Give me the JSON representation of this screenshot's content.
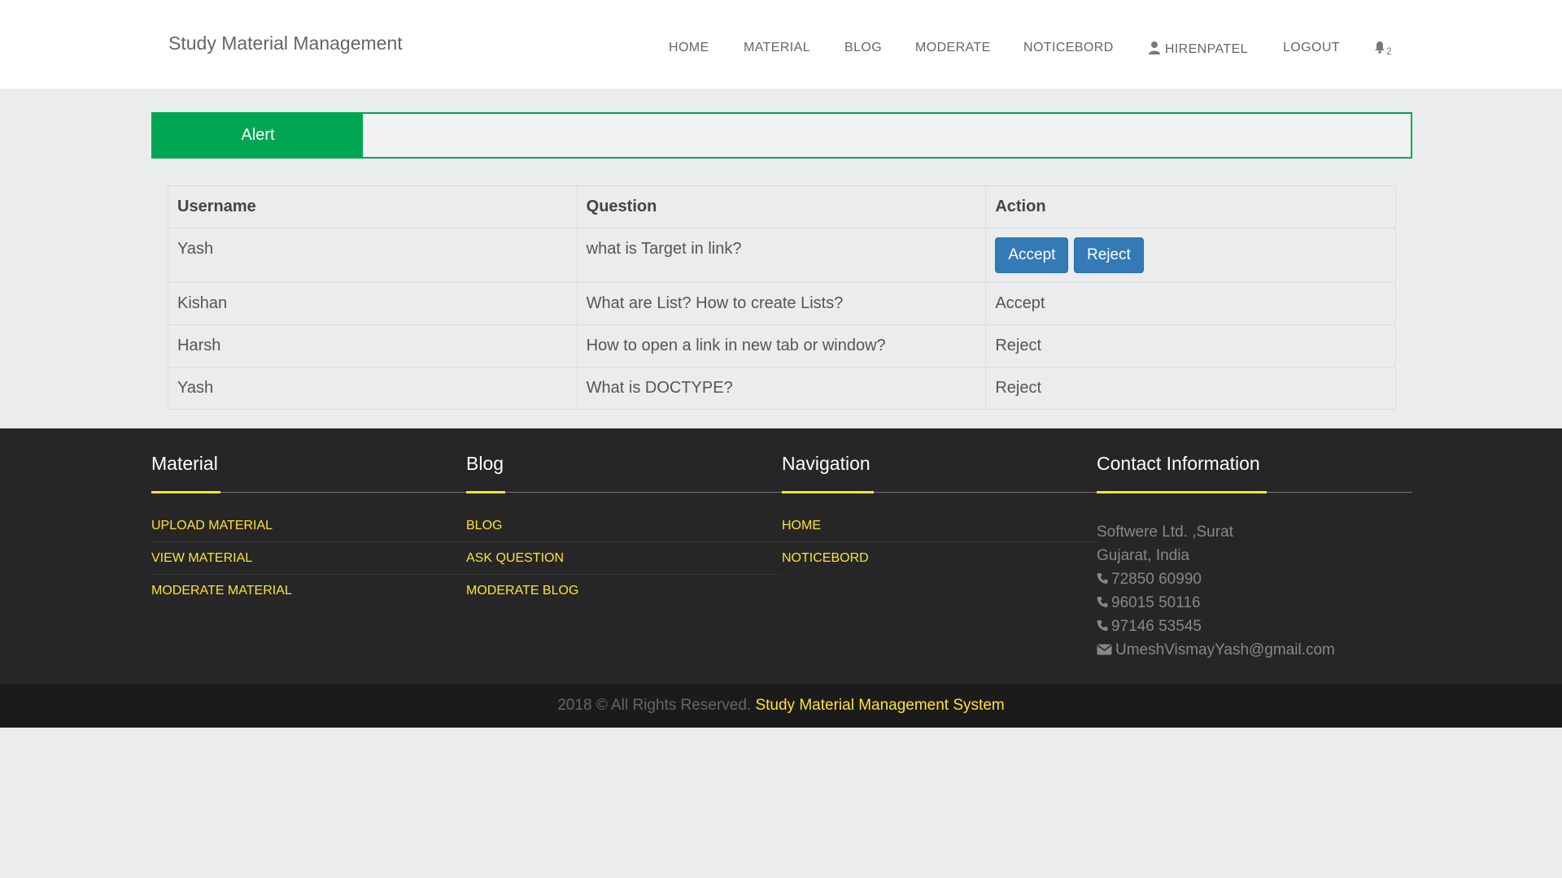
{
  "brand": "Study Material Management",
  "nav": {
    "home": "HOME",
    "material": "MATERIAL",
    "blog": "BLOG",
    "moderate": "MODERATE",
    "noticebord": "NOTICEBORD",
    "user": "HIRENPATEL",
    "logout": "LOGOUT",
    "notification_count": "2"
  },
  "alert": {
    "label": "Alert",
    "message": ""
  },
  "table": {
    "headers": [
      "Username",
      "Question",
      "Action"
    ],
    "rows": [
      {
        "username": "Yash",
        "question": "what is Target in link?",
        "accept_label": "Accept",
        "reject_label": "Reject"
      },
      {
        "username": "Kishan",
        "question": "What are List? How to create Lists?",
        "action": "Accept"
      },
      {
        "username": "Harsh",
        "question": "How to open a link in new tab or window?",
        "action": "Reject"
      },
      {
        "username": "Yash",
        "question": "What is DOCTYPE?",
        "action": "Reject"
      }
    ]
  },
  "footer": {
    "material": {
      "title": "Material",
      "links": [
        "UPLOAD MATERIAL",
        "VIEW MATERIAL",
        "MODERATE MATERIAL"
      ]
    },
    "blog": {
      "title": "Blog",
      "links": [
        "BLOG",
        "ASK QUESTION",
        "MODERATE BLOG"
      ]
    },
    "navigation": {
      "title": "Navigation",
      "links": [
        "HOME",
        "NOTICEBORD"
      ]
    },
    "contact": {
      "title": "Contact Information",
      "address1": "Softwere Ltd. ,Surat",
      "address2": "Gujarat, India",
      "phones": [
        "72850 60990",
        "96015 50116",
        "97146 53545"
      ],
      "email": "UmeshVismayYash@gmail.com"
    }
  },
  "copyright": {
    "text": "2018 © All Rights Reserved.",
    "system": "Study Material Management System"
  },
  "colors": {
    "accent_green": "#00a651",
    "footer_yellow": "#ffe135",
    "button_blue": "#337ab7"
  }
}
